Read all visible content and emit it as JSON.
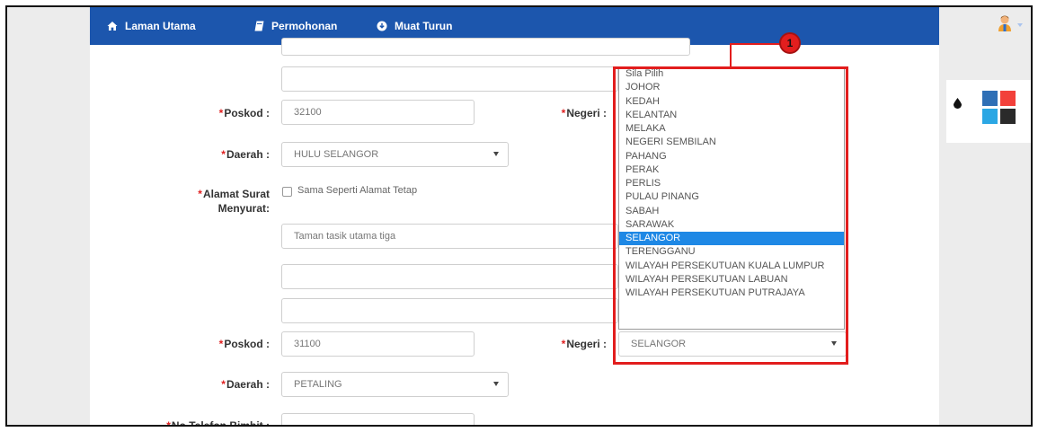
{
  "navbar": {
    "items": [
      {
        "label": "Laman Utama",
        "icon": "home-icon"
      },
      {
        "label": "Permohonan",
        "icon": "book-icon"
      },
      {
        "label": "Muat Turun",
        "icon": "download-icon"
      }
    ],
    "avatar_icon": "user-avatar-icon"
  },
  "form": {
    "required_marker": "*",
    "poskod1": {
      "label": "Poskod :",
      "value": "32100"
    },
    "negeri1": {
      "label": "Negeri :"
    },
    "daerah1": {
      "label": "Daerah :",
      "value": "HULU SELANGOR"
    },
    "alamat_surat": {
      "label_line1": "Alamat Surat",
      "label_line2": "Menyurat:",
      "checkbox_label": "Sama Seperti Alamat Tetap",
      "line1_value": "Taman tasik utama tiga",
      "line2_value": "",
      "line3_value": ""
    },
    "poskod2": {
      "label": "Poskod :",
      "value": "31100"
    },
    "negeri2": {
      "label": "Negeri :",
      "value": "SELANGOR"
    },
    "daerah2": {
      "label": "Daerah :",
      "value": "PETALING"
    },
    "telefon": {
      "label": "No Telefon Bimbit :",
      "value": ""
    }
  },
  "negeri_dropdown": {
    "options": [
      "Sila Pilih",
      "JOHOR",
      "KEDAH",
      "KELANTAN",
      "MELAKA",
      "NEGERI SEMBILAN",
      "PAHANG",
      "PERAK",
      "PERLIS",
      "PULAU PINANG",
      "SABAH",
      "SARAWAK",
      "SELANGOR",
      "TERENGGANU",
      "WILAYAH PERSEKUTUAN KUALA LUMPUR",
      "WILAYAH PERSEKUTUAN LABUAN",
      "WILAYAH PERSEKUTUAN PUTRAJAYA"
    ],
    "selected": "SELANGOR"
  },
  "callout": {
    "number": "1",
    "color": "#e21d1d"
  },
  "theme_panel": {
    "icon": "droplet-icon",
    "swatches": [
      "#2e6fb6",
      "#f2403a",
      "#2ba7e4",
      "#2a2a2a"
    ]
  },
  "colors": {
    "nav_bg": "#1c56ad",
    "selected_option": "#1e88e5",
    "required": "#e02020"
  }
}
